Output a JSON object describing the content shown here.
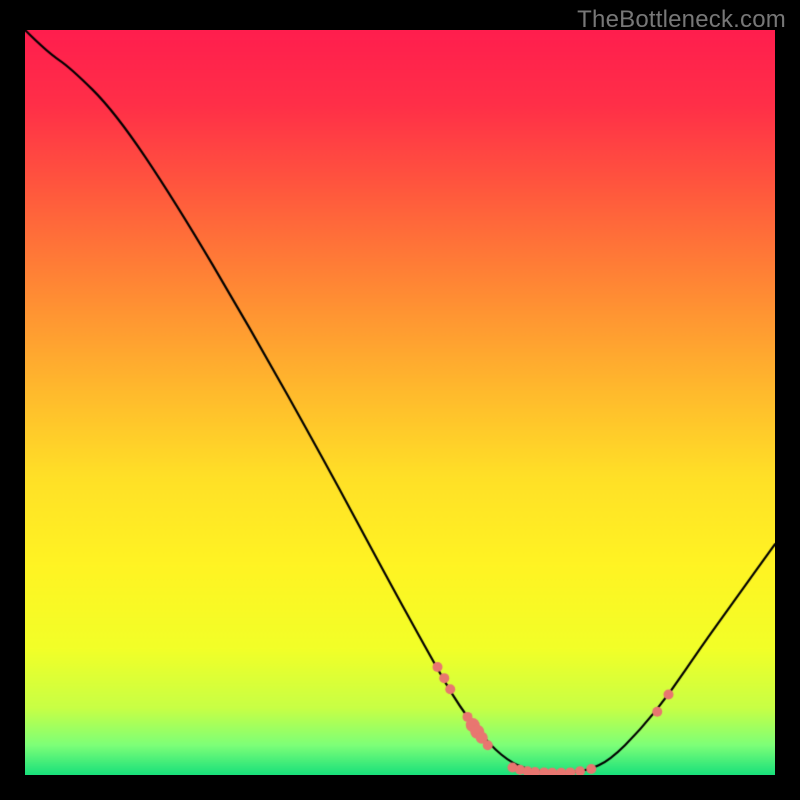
{
  "watermark": "TheBottleneck.com",
  "chart_data": {
    "type": "line",
    "title": "",
    "xlabel": "",
    "ylabel": "",
    "xlim": [
      0,
      100
    ],
    "ylim": [
      0,
      100
    ],
    "grid": false,
    "curve": [
      {
        "x": 0,
        "y": 100
      },
      {
        "x": 3,
        "y": 97
      },
      {
        "x": 6,
        "y": 95
      },
      {
        "x": 12,
        "y": 89
      },
      {
        "x": 20,
        "y": 77
      },
      {
        "x": 30,
        "y": 60
      },
      {
        "x": 40,
        "y": 42
      },
      {
        "x": 48,
        "y": 27
      },
      {
        "x": 54,
        "y": 16
      },
      {
        "x": 58,
        "y": 9
      },
      {
        "x": 62,
        "y": 4
      },
      {
        "x": 65,
        "y": 1.5
      },
      {
        "x": 68,
        "y": 0.5
      },
      {
        "x": 72,
        "y": 0.3
      },
      {
        "x": 75,
        "y": 0.6
      },
      {
        "x": 78,
        "y": 2
      },
      {
        "x": 82,
        "y": 6
      },
      {
        "x": 86,
        "y": 11
      },
      {
        "x": 90,
        "y": 17
      },
      {
        "x": 95,
        "y": 24
      },
      {
        "x": 100,
        "y": 31
      }
    ],
    "clusters": [
      {
        "x": 55.0,
        "y": 14.5,
        "r": 5
      },
      {
        "x": 55.9,
        "y": 13.0,
        "r": 5
      },
      {
        "x": 56.7,
        "y": 11.5,
        "r": 5
      },
      {
        "x": 59.0,
        "y": 7.8,
        "r": 5
      },
      {
        "x": 59.7,
        "y": 6.7,
        "r": 7
      },
      {
        "x": 60.3,
        "y": 5.8,
        "r": 7
      },
      {
        "x": 60.9,
        "y": 5.0,
        "r": 6
      },
      {
        "x": 61.7,
        "y": 4.0,
        "r": 5
      },
      {
        "x": 65.0,
        "y": 1.0,
        "r": 5
      },
      {
        "x": 66.0,
        "y": 0.7,
        "r": 5
      },
      {
        "x": 67.0,
        "y": 0.5,
        "r": 5
      },
      {
        "x": 68.0,
        "y": 0.4,
        "r": 5
      },
      {
        "x": 69.2,
        "y": 0.35,
        "r": 5
      },
      {
        "x": 70.3,
        "y": 0.3,
        "r": 5
      },
      {
        "x": 71.5,
        "y": 0.3,
        "r": 5
      },
      {
        "x": 72.7,
        "y": 0.35,
        "r": 5
      },
      {
        "x": 74.0,
        "y": 0.5,
        "r": 5
      },
      {
        "x": 75.5,
        "y": 0.8,
        "r": 5
      },
      {
        "x": 84.3,
        "y": 8.5,
        "r": 5
      },
      {
        "x": 85.8,
        "y": 10.8,
        "r": 5
      }
    ],
    "gradient_stops": [
      {
        "t": 0.0,
        "color": "#ff1e4e"
      },
      {
        "t": 0.1,
        "color": "#ff2f48"
      },
      {
        "t": 0.22,
        "color": "#ff5a3d"
      },
      {
        "t": 0.35,
        "color": "#ff8a34"
      },
      {
        "t": 0.48,
        "color": "#ffb82d"
      },
      {
        "t": 0.6,
        "color": "#ffe027"
      },
      {
        "t": 0.72,
        "color": "#fff423"
      },
      {
        "t": 0.83,
        "color": "#f2ff28"
      },
      {
        "t": 0.91,
        "color": "#c8ff45"
      },
      {
        "t": 0.96,
        "color": "#7dff78"
      },
      {
        "t": 1.0,
        "color": "#18e07b"
      }
    ],
    "dot_color": "#e87670",
    "curve_color": "#000000",
    "curve_width": 2.2
  }
}
